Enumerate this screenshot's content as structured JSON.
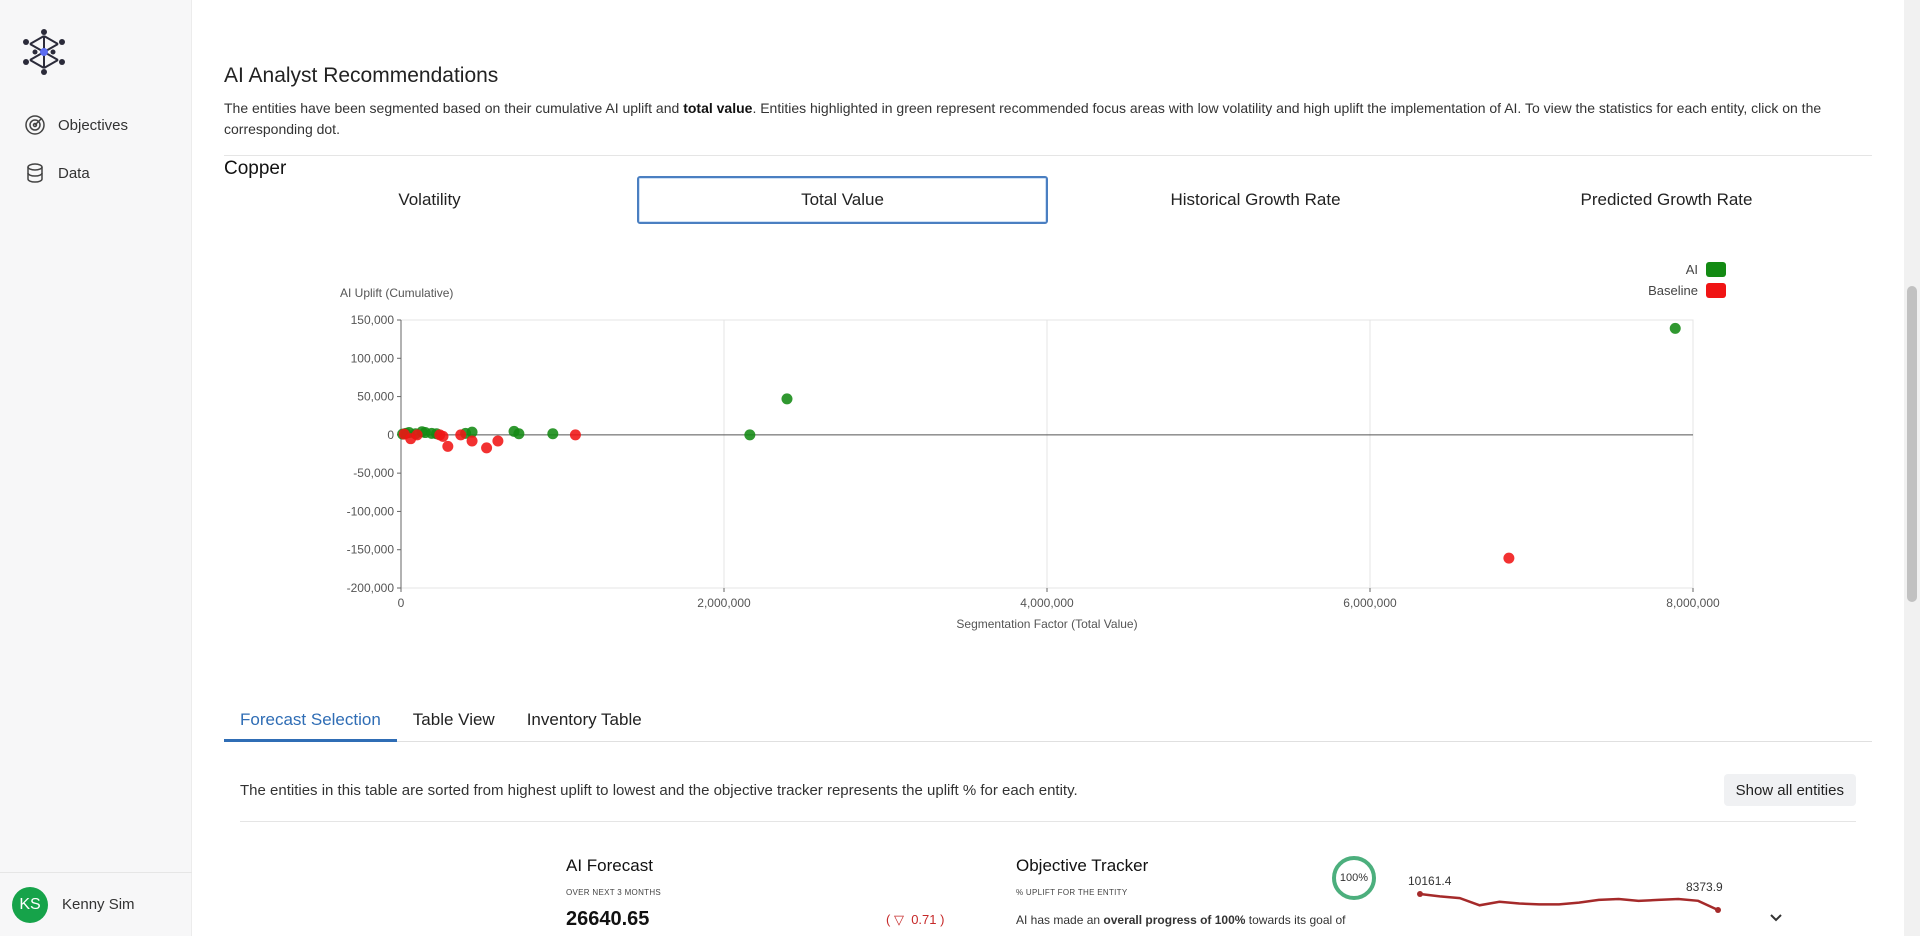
{
  "user": {
    "initials": "KS",
    "name": "Kenny Sim"
  },
  "sidebar": {
    "items": [
      {
        "label": "Objectives",
        "icon": "target-icon"
      },
      {
        "label": "Data",
        "icon": "database-icon"
      }
    ]
  },
  "section": {
    "title": "AI Analyst Recommendations",
    "desc_part1": "The entities have been segmented based on their cumulative AI uplift and ",
    "desc_bold": "total value",
    "desc_part2": ". Entities highlighted in green represent recommended focus areas with low volatility and high uplift the implementation of AI. To view the statistics for each entity, click on the corresponding dot."
  },
  "segment_tabs": [
    "Volatility",
    "Total Value",
    "Historical Growth Rate",
    "Predicted Growth Rate"
  ],
  "segment_active": "Total Value",
  "chart_data": {
    "type": "scatter",
    "ylabel": "AI Uplift (Cumulative)",
    "xlabel": "Segmentation Factor (Total Value)",
    "xlim": [
      0,
      8000000
    ],
    "ylim": [
      -200000,
      150000
    ],
    "x_ticks": [
      "0",
      "2,000,000",
      "4,000,000",
      "6,000,000",
      "8,000,000"
    ],
    "y_ticks": [
      "150,000",
      "100,000",
      "50,000",
      "0",
      "-50,000",
      "-100,000",
      "-150,000",
      "-200,000"
    ],
    "legend": [
      {
        "name": "AI",
        "color": "#138a13"
      },
      {
        "name": "Baseline",
        "color": "#f01414"
      }
    ],
    "grid": true,
    "legend_position": "top-right",
    "series": [
      {
        "name": "AI",
        "color": "#138a13",
        "points": [
          [
            10000,
            1000
          ],
          [
            30000,
            2000
          ],
          [
            50000,
            3000
          ],
          [
            90000,
            1500
          ],
          [
            130000,
            4000
          ],
          [
            150000,
            3000
          ],
          [
            190000,
            2000
          ],
          [
            220000,
            1500
          ],
          [
            400000,
            2000
          ],
          [
            440000,
            3500
          ],
          [
            700000,
            4500
          ],
          [
            730000,
            1500
          ],
          [
            940000,
            1500
          ],
          [
            2160000,
            0
          ],
          [
            2390000,
            47000
          ],
          [
            7890000,
            139000
          ]
        ]
      },
      {
        "name": "Baseline",
        "color": "#f01414",
        "points": [
          [
            20000,
            1000
          ],
          [
            60000,
            -5000
          ],
          [
            100000,
            0
          ],
          [
            240000,
            0
          ],
          [
            260000,
            -2000
          ],
          [
            290000,
            -15000
          ],
          [
            370000,
            0
          ],
          [
            440000,
            -8000
          ],
          [
            530000,
            -17000
          ],
          [
            600000,
            -8000
          ],
          [
            1080000,
            0
          ],
          [
            6860000,
            -161000
          ]
        ]
      }
    ]
  },
  "bottom_tabs": [
    "Forecast Selection",
    "Table View",
    "Inventory Table"
  ],
  "bottom_active": "Forecast Selection",
  "panel": {
    "info": "The entities in this table are sorted from highest uplift to lowest and the objective tracker represents the uplift % for each entity.",
    "show_all": "Show all entities"
  },
  "entity": {
    "name": "Copper",
    "forecast_title": "AI Forecast",
    "forecast_sub": "OVER NEXT 3 MONTHS",
    "forecast_value": "26640.65",
    "forecast_change": "0.71",
    "tracker_title": "Objective Tracker",
    "tracker_sub": "% UPLIFT FOR THE ENTITY",
    "tracker_pct": "100%",
    "tracker_text_1": "AI has made an ",
    "tracker_text_bold": "overall progress of 100%",
    "tracker_text_2": " towards its goal of",
    "spark_start": "10161.4",
    "spark_end": "8373.9",
    "spark_values": [
      10161.4,
      9900,
      9700,
      8900,
      9300,
      9100,
      9000,
      9000,
      9200,
      9500,
      9600,
      9400,
      9500,
      9600,
      9400,
      8373.9
    ]
  }
}
